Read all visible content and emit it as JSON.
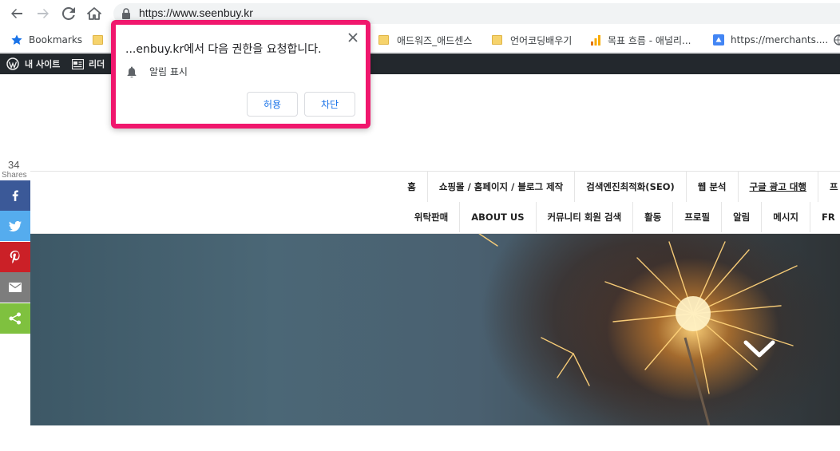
{
  "browser": {
    "url": "https://www.seenbuy.kr",
    "bookmarks": [
      {
        "label": "Bookmarks",
        "icon": "star-icon"
      },
      {
        "label": "애드워즈_애드센스",
        "icon": "folder-icon"
      },
      {
        "label": "언어코딩배우기",
        "icon": "folder-icon"
      },
      {
        "label": "목표 흐름 - 애널리...",
        "icon": "analytics-icon"
      },
      {
        "label": "https://merchants....",
        "icon": "merchant-icon"
      }
    ]
  },
  "adminbar": {
    "my_site": "내 사이트",
    "reader": "리더"
  },
  "permission_popup": {
    "title": "...enbuy.kr에서 다음 권한을 요청합니다.",
    "permission": "알림 표시",
    "allow_label": "허용",
    "block_label": "차단"
  },
  "share": {
    "count": "34",
    "label": "Shares",
    "accent_colors": {
      "facebook": "#3b5998",
      "twitter": "#55acee",
      "pinterest": "#cb2027",
      "email": "#7d7d7d",
      "share": "#7fc13f"
    }
  },
  "menu": {
    "row1": [
      "홈",
      "쇼핑몰 / 홈페이지 / 블로그 제작",
      "검색엔진최적화(SEO)",
      "웹 분석",
      "구글 광고 대행",
      "프"
    ],
    "row2": [
      "위탁판매",
      "ABOUT US",
      "커뮤니티 회원 검색",
      "활동",
      "프로필",
      "알림",
      "메시지",
      "FR"
    ]
  },
  "popup_highlight_color": "#f0176d"
}
